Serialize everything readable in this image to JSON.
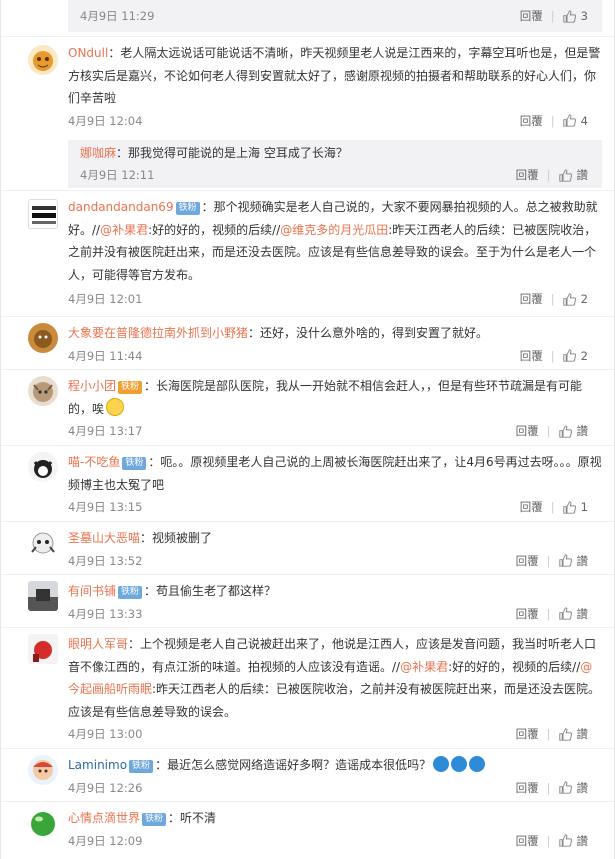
{
  "top": {
    "time": "4月9日 11:29",
    "reply_label": "回覆",
    "likes": "3"
  },
  "comments": [
    {
      "user": "ONdull",
      "badge": "",
      "text": "：老人隔太远说话可能说话不清晰，昨天视频里老人说是江西来的，字幕空耳听也是，但是警方核实后是嘉兴，不论如何老人得到安置就太好了，感谢原视频的拍摄者和帮助联系的好心人们，你们辛苦啦",
      "time": "4月9日 12:04",
      "reply_label": "回覆",
      "likes": "4",
      "reply": {
        "user": "娜咖麻",
        "text": "：那我觉得可能说的是上海 空耳成了长海？",
        "time": "4月9日 12:11",
        "reply_label": "回覆",
        "like_label": "讚"
      }
    },
    {
      "user": "dandandandan69",
      "badge": "铁粉",
      "text_parts": [
        "：那个视频确实是老人自己说的，大家不要网暴拍视频的人。总之被救助就好。//",
        "@补果君",
        ":好的好的，视频的后续//",
        "@维克多的月光瓜田",
        ":昨天江西老人的后续：已被医院收治，之前并没有被医院赶出来，而是还没去医院。应该是有些信息差导致的误会。至于为什么是老人一个人，可能得等官方发布。"
      ],
      "time": "4月9日 12:01",
      "reply_label": "回覆",
      "likes": "2"
    },
    {
      "user": "大象要在普隆德拉南外抓到小野猪",
      "badge": "",
      "text": "：还好，没什么意外啥的，得到安置了就好。",
      "time": "4月9日 11:44",
      "reply_label": "回覆",
      "likes": "2"
    },
    {
      "user": "程小小团",
      "badge": "铁粉",
      "text": "：长海医院是部队医院，我从一开始就不相信会赶人，，但是有些环节疏漏是有可能的，唉",
      "time": "4月9日 13:17",
      "reply_label": "回覆",
      "like_label": "讚"
    },
    {
      "user": "喵-不吃鱼",
      "badge": "铁粉",
      "text": "：呃。。原视频里老人自己说的上周被长海医院赶出来了，让4月6号再过去呀。。。原视频博主也太冤了吧",
      "time": "4月9日 13:15",
      "reply_label": "回覆",
      "likes": "1"
    },
    {
      "user": "圣墓山大恶喵",
      "badge": "",
      "text": "：视频被删了",
      "time": "4月9日 13:52",
      "reply_label": "回覆",
      "like_label": "讚"
    },
    {
      "user": "有间书铺",
      "badge": "铁粉",
      "text": "：苟且偷生老了都这样？",
      "time": "4月9日 13:33",
      "reply_label": "回覆",
      "like_label": "讚"
    },
    {
      "user": "眼明人军哥",
      "badge": "",
      "text_parts": [
        "：上个视频是老人自己说被赶出来了，他说是江西人，应该是发音问题，我当时听老人口音不像江西的，有点江浙的味道。拍视频的人应该没有造谣。//",
        "@补果君",
        ":好的好的，视频的后续//",
        "@今起画船听雨眠",
        ":昨天江西老人的后续：已被医院收治，之前并没有被医院赶出来，而是还没去医院。应该是有些信息差导致的误会。"
      ],
      "time": "4月9日 13:00",
      "reply_label": "回覆",
      "like_label": "讚"
    },
    {
      "user": "Laminimo",
      "badge": "铁粉",
      "text": "：最近怎么感觉网络造谣好多啊？造谣成本很低吗？",
      "time": "4月9日 12:26",
      "reply_label": "回覆",
      "like_label": "讚"
    },
    {
      "user": "心情点滴世界",
      "badge": "铁粉",
      "text": "：听不清",
      "time": "4月9日 12:09",
      "reply_label": "回覆",
      "like_label": "讚"
    }
  ],
  "colors": {
    "username": "#eb7350",
    "badge": "#6fa8dc",
    "meta": "#888888"
  }
}
